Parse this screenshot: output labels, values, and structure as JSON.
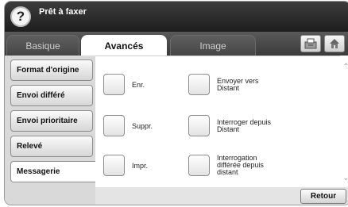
{
  "header": {
    "help_label": "?",
    "title": "Prêt à faxer"
  },
  "tabs": [
    {
      "label": "Basique"
    },
    {
      "label": "Avancés"
    },
    {
      "label": "Image"
    }
  ],
  "toolbar": {
    "icon1": "fax-status-icon",
    "icon2": "home-icon"
  },
  "sidebar": {
    "items": [
      {
        "label": "Format d'origine"
      },
      {
        "label": "Envoi différé"
      },
      {
        "label": "Envoi prioritaire"
      },
      {
        "label": "Relevé"
      },
      {
        "label": "Messagerie"
      }
    ]
  },
  "options": {
    "enr": "Enr.",
    "suppr": "Suppr.",
    "impr": "Impr.",
    "envoyer_line1": "Envoyer vers",
    "envoyer_line2": "Distant",
    "interroger_line1": "Interroger depuis",
    "interroger_line2": "Distant",
    "interrogation_line1": "Interrogation",
    "interrogation_line2": "différée depuis",
    "interrogation_line3": "distant"
  },
  "footer": {
    "retour_label": "Retour"
  }
}
